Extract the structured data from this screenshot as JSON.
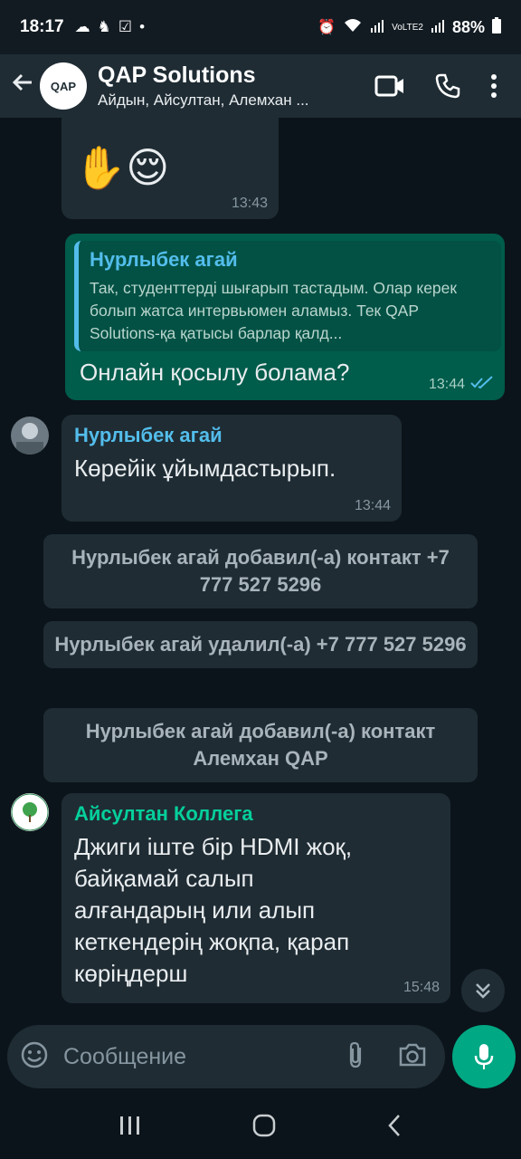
{
  "status_bar": {
    "time": "18:17",
    "battery": "88%",
    "network": "VoLTE2"
  },
  "header": {
    "title": "QAP Solutions",
    "subtitle": "Айдын, Айсултан, Алемхан ...",
    "avatar_text": "QAP"
  },
  "messages": {
    "m1": {
      "emoji": "✋😌",
      "time": "13:43"
    },
    "m2": {
      "quote_name": "Нурлыбек агай",
      "quote_text": "Так, студенттерді шығарып тастадым. Олар керек болып жатса интервьюмен аламыз. Тек QAP Solutions-қа қатысы барлар қалд...",
      "text": "Онлайн қосылу болама?",
      "time": "13:44"
    },
    "m3": {
      "sender": "Нурлыбек агай",
      "text": "Көрейік ұйымдастырып.",
      "time": "13:44"
    },
    "sys1": "Нурлыбек агай добавил(-а) контакт +7 777 527 5296",
    "sys2": "Нурлыбек агай удалил(-а) +7 777 527 5296",
    "sys3": "Нурлыбек агай добавил(-а) контакт Алемхан QAP",
    "m4": {
      "sender": "Айсултан Коллега",
      "text": "Джиги іште бір HDMI жоқ, байқамай салып алғандарың или алып кеткендерің жоқпа, қарап көріңдерш",
      "time": "15:48"
    }
  },
  "input": {
    "placeholder": "Сообщение"
  },
  "colors": {
    "accent": "#00a884",
    "outgoing": "#005c4b",
    "incoming": "#1f2c34",
    "quote_name": "#53bdeb",
    "sender_blue": "#53bdeb",
    "sender_green": "#06cf9c"
  }
}
